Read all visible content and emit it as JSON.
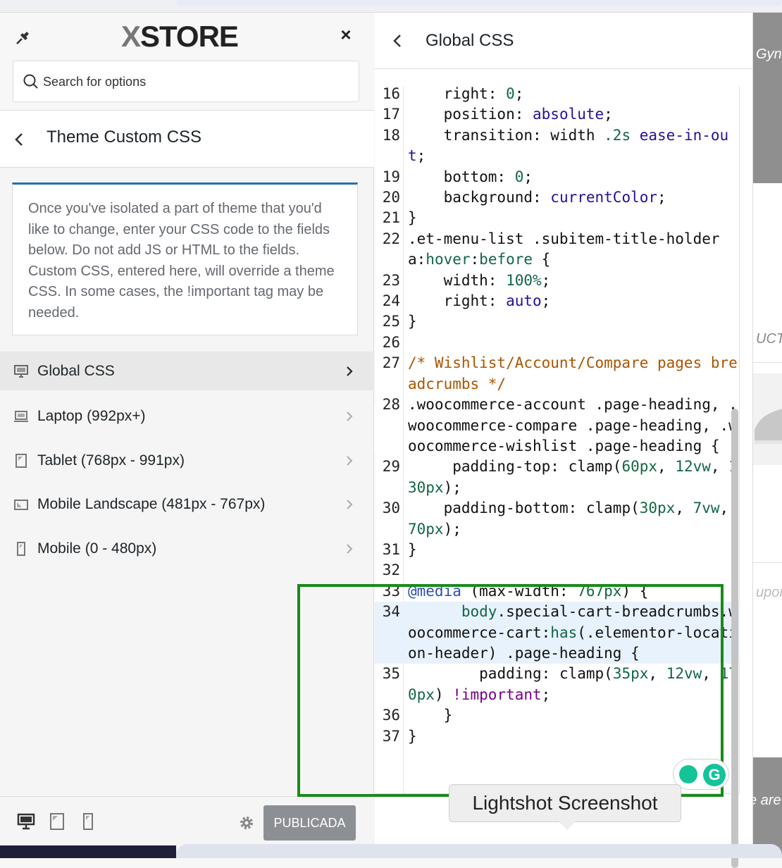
{
  "header": {
    "logo_text_x": "X",
    "logo_text_store": "STORE",
    "close_glyph": "×"
  },
  "search": {
    "placeholder": "Search for options"
  },
  "section": {
    "title": "Theme Custom CSS",
    "description": "Once you've isolated a part of theme that you'd like to change, enter your CSS code to the fields below. Do not add JS or HTML to the fields. Custom CSS, entered here, will override a theme CSS. In some cases, the !important tag may be needed."
  },
  "nav": {
    "items": [
      {
        "label": "Global CSS",
        "icon": "desktop-icon",
        "active": true
      },
      {
        "label": "Laptop (992px+)",
        "icon": "laptop-icon",
        "active": false
      },
      {
        "label": "Tablet (768px - 991px)",
        "icon": "tablet-icon",
        "active": false
      },
      {
        "label": "Mobile Landscape (481px - 767px)",
        "icon": "mobile-landscape-icon",
        "active": false
      },
      {
        "label": "Mobile (0 - 480px)",
        "icon": "mobile-icon",
        "active": false
      }
    ]
  },
  "footer": {
    "publish_label": "PUBLICADA"
  },
  "editor": {
    "title": "Global CSS",
    "line_numbers": [
      "16",
      "17",
      "18",
      "19",
      "20",
      "21",
      "22",
      "23",
      "24",
      "25",
      "26",
      "27",
      "28",
      "29",
      "30",
      "31",
      "32",
      "33",
      "34",
      "35",
      "36",
      "37"
    ]
  },
  "tooltip": {
    "text": "Lightshot Screenshot"
  },
  "grammarly": {
    "letter": "G"
  },
  "preview": {
    "texts": [
      "Gyn",
      "UCT",
      "upor",
      "e are"
    ]
  },
  "colors": {
    "accent": "#2271b1",
    "publish_bg": "#8c8f94",
    "highlight_box": "#1a8a1a",
    "grammarly": "#15c39a"
  }
}
